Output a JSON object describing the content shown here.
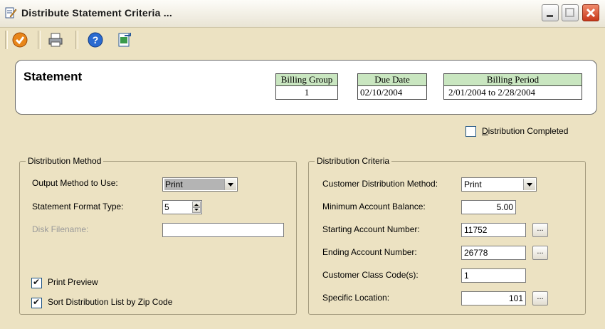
{
  "window": {
    "title": "Distribute Statement Criteria  ..."
  },
  "toolbar": {
    "icons": [
      "accept-icon",
      "printer-icon",
      "help-icon",
      "export-icon"
    ]
  },
  "header": {
    "title": "Statement",
    "billing_group_label": "Billing Group",
    "billing_group_value": "1",
    "due_date_label": "Due Date",
    "due_date_value": "02/10/2004",
    "billing_period_label": "Billing Period",
    "billing_period_value": "2/01/2004 to  2/28/2004"
  },
  "distribution_completed": {
    "label_first": "D",
    "label_rest": "istribution Completed",
    "checked": false
  },
  "distribution_method": {
    "group_title": "Distribution Method",
    "output_method_label": "Output Method to Use:",
    "output_method_value": "Print",
    "format_type_label": "Statement Format Type:",
    "format_type_value": "5",
    "disk_filename_label": "Disk Filename:",
    "disk_filename_value": "",
    "print_preview_label": "Print Preview",
    "print_preview_checked": true,
    "sort_zip_label": "Sort Distribution List by Zip Code",
    "sort_zip_checked": true
  },
  "distribution_criteria": {
    "group_title": "Distribution Criteria",
    "customer_method_label": "Customer Distribution Method:",
    "customer_method_value": "Print",
    "min_balance_label": "Minimum Account Balance:",
    "min_balance_value": "5.00",
    "start_account_label": "Starting Account Number:",
    "start_account_value": "11752",
    "end_account_label": "Ending Account Number:",
    "end_account_value": "26778",
    "class_code_label": "Customer Class Code(s):",
    "class_code_value": "1",
    "location_label": "Specific Location:",
    "location_value": "101",
    "ellipsis": "..."
  }
}
